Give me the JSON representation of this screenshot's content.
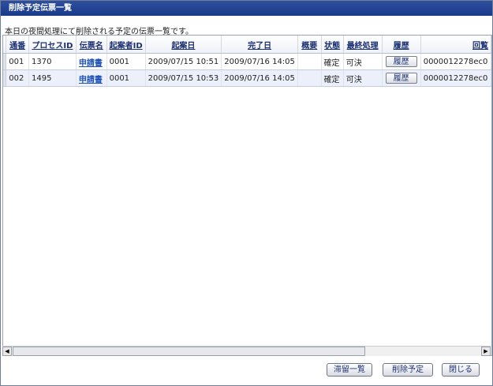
{
  "window": {
    "title": "削除予定伝票一覧"
  },
  "description": "本日の夜間処理にて削除される予定の伝票一覧です。",
  "table": {
    "columns": [
      "通番",
      "プロセスID",
      "伝票名",
      "起案者ID",
      "起案日",
      "完了日",
      "概要",
      "状態",
      "最終処理",
      "履歴",
      "回覧"
    ],
    "rows": [
      {
        "no": "001",
        "process_id": "1370",
        "doc_name": "申請書",
        "drafter_id": "0001",
        "draft_date": "2009/07/15 10:51",
        "complete_date": "2009/07/16 14:05",
        "summary": "",
        "status": "確定",
        "final": "可決",
        "history_btn": "履歴",
        "circulation": "0000012278ec0"
      },
      {
        "no": "002",
        "process_id": "1495",
        "doc_name": "申請書",
        "drafter_id": "0001",
        "draft_date": "2009/07/15 10:53",
        "complete_date": "2009/07/16 14:05",
        "summary": "",
        "status": "確定",
        "final": "可決",
        "history_btn": "履歴",
        "circulation": "0000012278ec0"
      }
    ]
  },
  "scrollbar": {
    "left_arrow": "◀",
    "right_arrow": "▶"
  },
  "footer": {
    "pending_list": "滞留一覧",
    "delete_scheduled": "削除予定",
    "close": "閉じる"
  }
}
